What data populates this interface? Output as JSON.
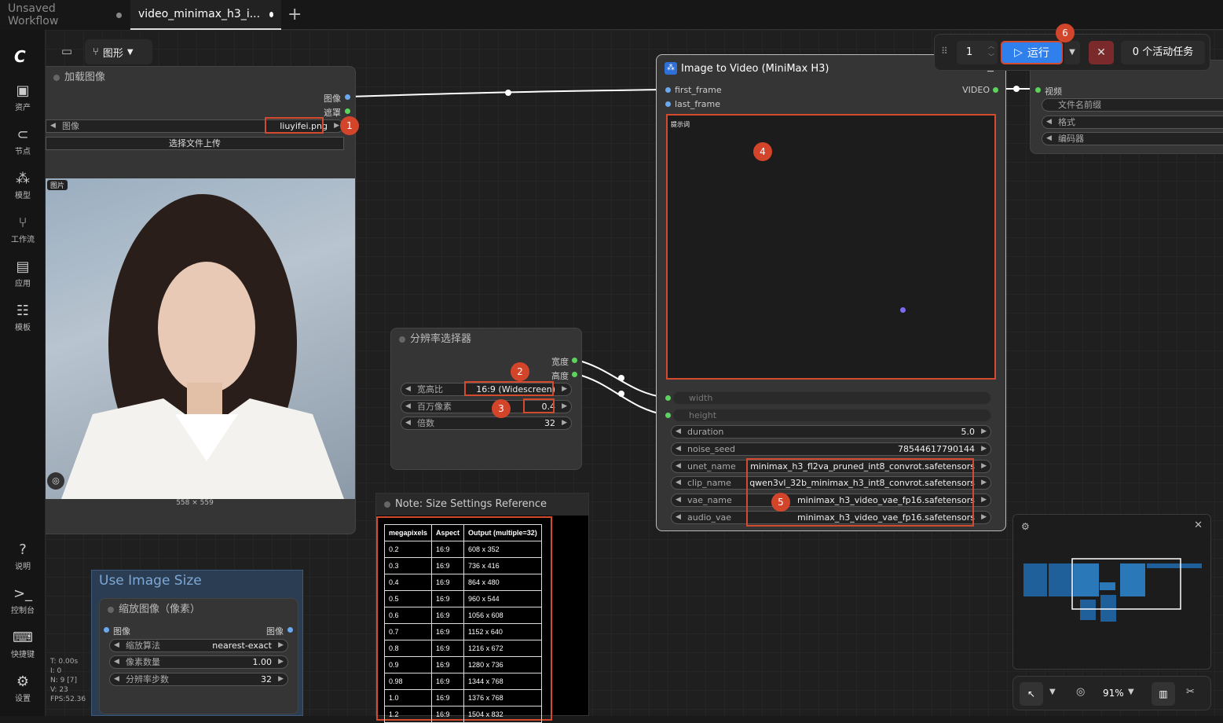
{
  "tabs": [
    {
      "label": "Unsaved Workflow"
    },
    {
      "label": "video_minimax_h3_i..."
    }
  ],
  "toolbar": {
    "graph_label": "图形",
    "queue_count": "1",
    "run_label": "运行",
    "active_tasks": "0 个活动任务"
  },
  "sidebar": {
    "items": [
      {
        "label": "资产",
        "icon": "image-icon"
      },
      {
        "label": "节点",
        "icon": "node-icon"
      },
      {
        "label": "模型",
        "icon": "model-icon"
      },
      {
        "label": "工作流",
        "icon": "workflow-icon"
      },
      {
        "label": "应用",
        "icon": "app-icon"
      },
      {
        "label": "模板",
        "icon": "template-icon"
      }
    ],
    "bottom": [
      {
        "label": "说明",
        "icon": "help-icon"
      },
      {
        "label": "控制台",
        "icon": "terminal-icon"
      },
      {
        "label": "快捷键",
        "icon": "keyboard-icon"
      },
      {
        "label": "设置",
        "icon": "gear-icon"
      }
    ]
  },
  "load_image": {
    "title": "加载图像",
    "out_image": "图像",
    "out_mask": "遮罩",
    "image_label": "图像",
    "image_value": "liuyifei.png",
    "upload_label": "选择文件上传",
    "preview_tag": "图片",
    "dims": "558 × 559"
  },
  "resolution": {
    "title": "分辨率选择器",
    "out_width": "宽度",
    "out_height": "高度",
    "aspect_label": "宽高比",
    "aspect_value": "16:9 (Widescreen)",
    "mp_label": "百万像素",
    "mp_value": "0.4",
    "mult_label": "倍数",
    "mult_value": "32"
  },
  "i2v": {
    "title": "Image to Video (MiniMax H3)",
    "in_first": "first_frame",
    "in_last": "last_frame",
    "out_video": "VIDEO",
    "prompt_label": "提示词",
    "in_width": "width",
    "in_height": "height",
    "widgets": [
      {
        "label": "duration",
        "value": "5.0"
      },
      {
        "label": "noise_seed",
        "value": "78544617790144"
      },
      {
        "label": "unet_name",
        "value": "minimax_h3_fl2va_pruned_int8_convrot.safetensors"
      },
      {
        "label": "clip_name",
        "value": "qwen3vl_32b_minimax_h3_int8_convrot.safetensors"
      },
      {
        "label": "vae_name",
        "value": "minimax_h3_video_vae_fp16.safetensors"
      },
      {
        "label": "audio_vae",
        "value": "minimax_h3_video_vae_fp16.safetensors"
      }
    ]
  },
  "save_video": {
    "in_video": "视频",
    "w1": "文件名前缀",
    "w2": "格式",
    "w3": "编码器"
  },
  "note": {
    "title": "Note: Size Settings Reference",
    "headers": [
      "megapixels",
      "Aspect",
      "Output (multiple=32)"
    ],
    "rows": [
      [
        "0.2",
        "16:9",
        "608 x 352"
      ],
      [
        "0.3",
        "16:9",
        "736 x 416"
      ],
      [
        "0.4",
        "16:9",
        "864 x 480"
      ],
      [
        "0.5",
        "16:9",
        "960 x 544"
      ],
      [
        "0.6",
        "16:9",
        "1056 x 608"
      ],
      [
        "0.7",
        "16:9",
        "1152 x 640"
      ],
      [
        "0.8",
        "16:9",
        "1216 x 672"
      ],
      [
        "0.9",
        "16:9",
        "1280 x 736"
      ],
      [
        "0.98",
        "16:9",
        "1344 x 768"
      ],
      [
        "1.0",
        "16:9",
        "1376 x 768"
      ],
      [
        "1.2",
        "16:9",
        "1504 x 832"
      ]
    ]
  },
  "use_image_size": {
    "group_title": "Use Image Size",
    "node_title": "缩放图像（像素）",
    "in_image": "图像",
    "out_image": "图像",
    "w_algo_label": "缩放算法",
    "w_algo_value": "nearest-exact",
    "w_mp_label": "像素数量",
    "w_mp_value": "1.00",
    "w_step_label": "分辨率步数",
    "w_step_value": "32"
  },
  "stats": {
    "t": "T: 0.00s",
    "i": "I: 0",
    "n": "N: 9 [7]",
    "v": "V: 23",
    "fps": "FPS:52.36"
  },
  "zoom": "91%",
  "badges": [
    "1",
    "2",
    "3",
    "4",
    "5",
    "6"
  ],
  "colors": {
    "accent": "#2f80ed",
    "annotation": "#d44a2f",
    "port_green": "#5dd35d",
    "port_blue": "#6aa8f0"
  }
}
